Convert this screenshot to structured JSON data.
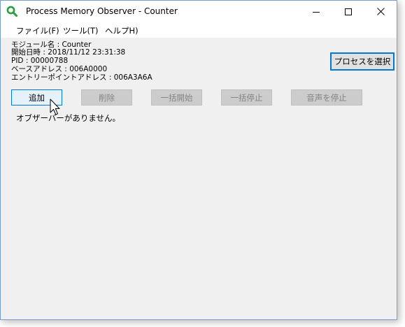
{
  "window": {
    "title": "Process Memory Observer - Counter"
  },
  "menu": {
    "items": [
      {
        "label": "ファイル(F)"
      },
      {
        "label": "ツール(T)"
      },
      {
        "label": "ヘルプH)"
      }
    ]
  },
  "info": {
    "module": "モジュール名 : Counter",
    "start_time": "開始日時 : 2018/11/12 23:31:38",
    "pid": "PID : 00000788",
    "base_address": "ベースアドレス : 006A0000",
    "entry_point": "エントリーポイントアドレス : 006A3A6A"
  },
  "toolbar": {
    "select_process_label": "プロセスを選択",
    "add_label": "追加",
    "delete_label": "削除",
    "start_all_label": "一括開始",
    "stop_all_label": "一括停止",
    "stop_sound_label": "音声を停止"
  },
  "observers": {
    "empty_message": "オブザーバーがありません。"
  },
  "colors": {
    "accent": "#0078d7",
    "window_bg": "#f0f0f0",
    "disabled_text": "#838383",
    "app_icon": "#2a9d3a"
  },
  "icons": {
    "app": "magnifier-icon",
    "minimize": "minimize-icon",
    "maximize": "maximize-icon",
    "close": "close-icon",
    "cursor": "mouse-pointer-icon"
  }
}
